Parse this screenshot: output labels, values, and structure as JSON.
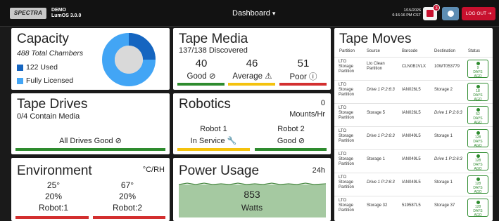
{
  "header": {
    "logo": "SPECTRA",
    "system_name_line1": "DEMO",
    "system_name_line2": "LumOS 3.0.0",
    "page_title": "Dashboard",
    "date": "1/15/2026",
    "time": "6:16:16 PM CST",
    "notification_count": "3",
    "logout_label": "LOG OUT"
  },
  "capacity": {
    "title": "Capacity",
    "total": "488 Total Chambers",
    "used_label": "122 Used",
    "licensed_label": "Fully Licensed",
    "used_fraction": 0.25,
    "used_color": "#1565c0",
    "licensed_color": "#42a5f5"
  },
  "tape_media": {
    "title": "Tape Media",
    "discovered": "137/138 Discovered",
    "good_count": "40",
    "average_count": "46",
    "poor_count": "51",
    "good_label": "Good ⊘",
    "average_label": "Average ⚠",
    "poor_label": "Poor ⓘ"
  },
  "tape_drives": {
    "title": "Tape Drives",
    "contain_media": "0/4 Contain Media",
    "status": "All Drives Good ⊘"
  },
  "robotics": {
    "title": "Robotics",
    "mounts_value": "0",
    "mounts_unit": "Mounts/Hr",
    "robot1_name": "Robot 1",
    "robot1_status": "In Service 🔧",
    "robot2_name": "Robot 2",
    "robot2_status": "Good ⊘"
  },
  "environment": {
    "title": "Environment",
    "unit": "°C/RH",
    "robot1_temp": "25°",
    "robot1_rh": "20%",
    "robot1_label": "Robot:1",
    "robot2_temp": "67°",
    "robot2_rh": "20%",
    "robot2_label": "Robot:2"
  },
  "power": {
    "title": "Power Usage",
    "period": "24h",
    "value": "853",
    "unit": "Watts"
  },
  "tape_moves": {
    "title": "Tape Moves",
    "columns": [
      "Partition",
      "Source",
      "Barcode",
      "Destination",
      "Status"
    ],
    "rows": [
      {
        "partition": "LTO\nStorage\nPartition",
        "source": "Lto Clean\nPartition",
        "barcode": "CLN0B1VLX",
        "destination": "10WT053779",
        "status": "9\nDAYS\nAGO"
      },
      {
        "partition": "LTO\nStorage\nPartition",
        "source": "Drive 1 P:2:6:3",
        "barcode": "IAN026L5",
        "destination": "Storage 2",
        "status": "18\nDAYS\nAGO"
      },
      {
        "partition": "LTO\nStorage\nPartition",
        "source": "Storage 5",
        "barcode": "IAN026L5",
        "destination": "Drive 1 P:2:6:3",
        "status": "52\nDAYS\nAGO"
      },
      {
        "partition": "LTO\nStorage\nPartition",
        "source": "Drive 1 P:2:6:3",
        "barcode": "IAN049L5",
        "destination": "Storage 1",
        "status": "128\nDAYS\nAGO"
      },
      {
        "partition": "LTO\nStorage\nPartition",
        "source": "Storage 1",
        "barcode": "IAN049L5",
        "destination": "Drive 1 P:2:6:3",
        "status": "128\nDAYS\nAGO"
      },
      {
        "partition": "LTO\nStorage\nPartition",
        "source": "Drive 1 P:2:6:3",
        "barcode": "IAN049L5",
        "destination": "Storage 1",
        "status": "128\nDAYS\nAGO"
      },
      {
        "partition": "LTO\nStorage\nPartition",
        "source": "Storage 32",
        "barcode": "519587L5",
        "destination": "Storage 37",
        "status": "128\nDAYS\nAGO"
      }
    ]
  }
}
